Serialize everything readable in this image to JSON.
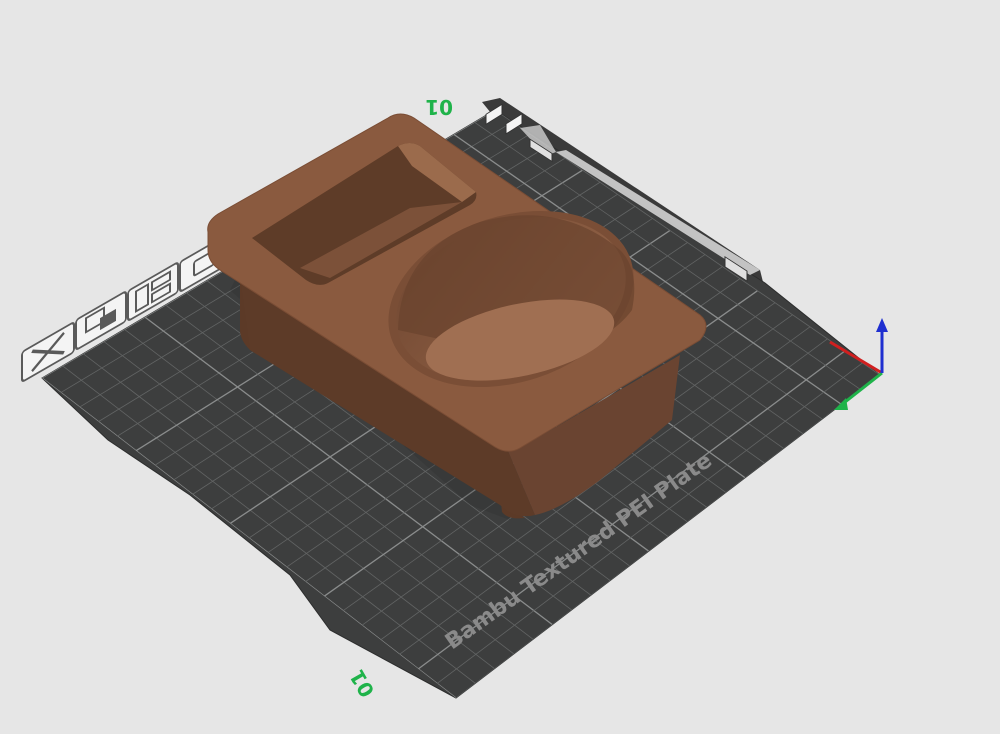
{
  "plate": {
    "label": "Bambu Textured PEI Plate",
    "number_top": "01",
    "number_bottom": "01"
  },
  "colors": {
    "background": "#e6e6e6",
    "plate": "#3d3e3e",
    "grid": "#6e7070",
    "model": "#8a5a3f",
    "axis_x": "#d01f1f",
    "axis_y": "#1fb34a",
    "axis_z": "#1f2fd0",
    "plate_number": "#1fb34a"
  },
  "plate_tools": [
    {
      "name": "close-plate-icon"
    },
    {
      "name": "arrange-icon",
      "label": "Arrange"
    },
    {
      "name": "plate-settings-icon"
    },
    {
      "name": "lock-icon"
    }
  ],
  "model": {
    "name": "cup-holder-model",
    "color": "#8a5a3f"
  }
}
